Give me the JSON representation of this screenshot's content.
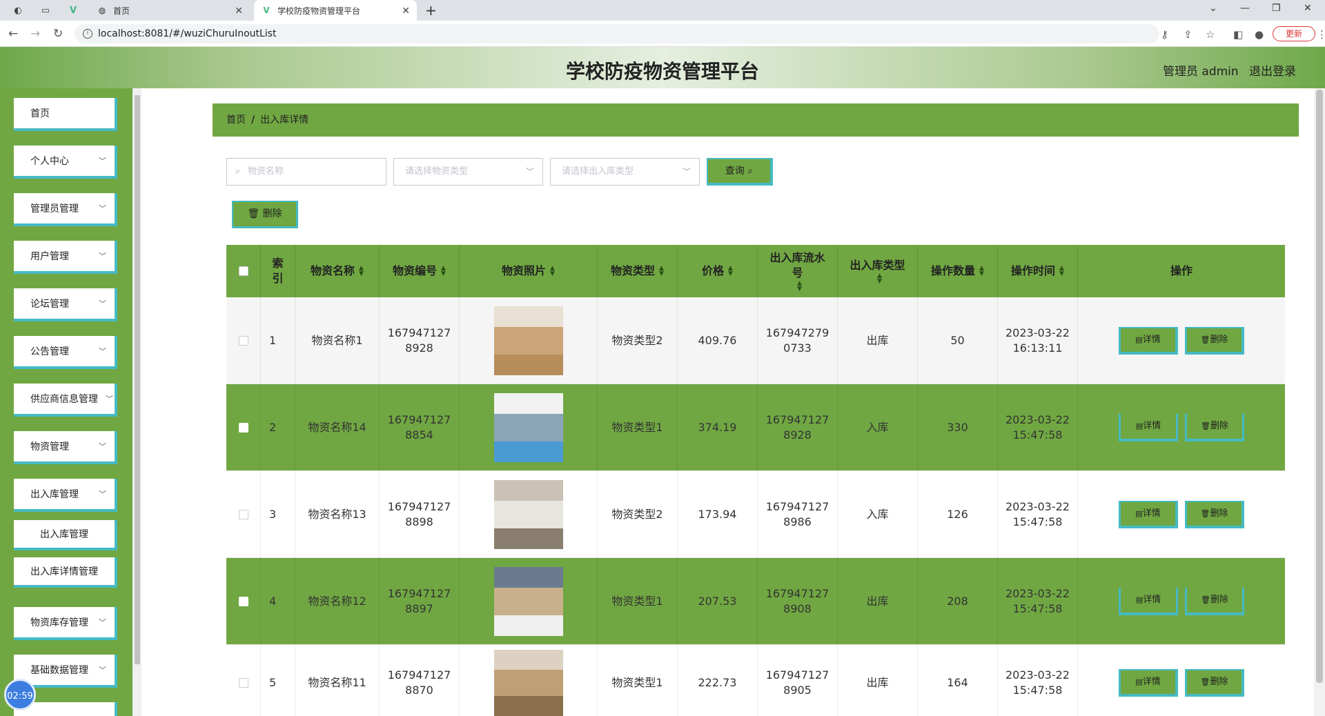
{
  "browser": {
    "tabs": [
      {
        "title": "首页"
      },
      {
        "title": "学校防疫物资管理平台"
      }
    ],
    "url": "localhost:8081/#/wuziChuruInoutList",
    "update_label": "更新"
  },
  "header": {
    "title": "学校防疫物资管理平台",
    "admin_label": "管理员 admin",
    "logout_label": "退出登录"
  },
  "sidebar": {
    "items": [
      {
        "label": "首页",
        "has_arrow": false
      },
      {
        "label": "个人中心",
        "has_arrow": true
      },
      {
        "label": "管理员管理",
        "has_arrow": true
      },
      {
        "label": "用户管理",
        "has_arrow": true
      },
      {
        "label": "论坛管理",
        "has_arrow": true
      },
      {
        "label": "公告管理",
        "has_arrow": true
      },
      {
        "label": "供应商信息管理",
        "has_arrow": true
      },
      {
        "label": "物资管理",
        "has_arrow": true
      },
      {
        "label": "出入库管理",
        "has_arrow": true
      }
    ],
    "subitems": [
      {
        "label": "出入库管理"
      },
      {
        "label": "出入库详情管理"
      }
    ],
    "items_after": [
      {
        "label": "物资库存管理"
      },
      {
        "label": "基础数据管理"
      }
    ],
    "clock": "02:59"
  },
  "breadcrumb": {
    "home": "首页",
    "current": "出入库详情"
  },
  "filters": {
    "name_placeholder": "物资名称",
    "type_placeholder": "请选择物资类型",
    "inout_placeholder": "请选择出入库类型",
    "query_label": "查询",
    "delete_label": "删除"
  },
  "table": {
    "headers": {
      "index": "索引",
      "name": "物资名称",
      "code": "物资编号",
      "photo": "物资照片",
      "type": "物资类型",
      "price": "价格",
      "serial": "出入库流水号",
      "inout_type": "出入库类型",
      "qty": "操作数量",
      "time": "操作时间",
      "ops": "操作"
    },
    "detail_label": "详情",
    "delete_label": "删除",
    "rows": [
      {
        "index": "1",
        "name": "物资名称1",
        "code": "1679471278928",
        "type": "物资类型2",
        "price": "409.76",
        "serial": "1679472790733",
        "inout": "出库",
        "qty": "50",
        "date": "2023-03-22",
        "time": "16:13:11"
      },
      {
        "index": "2",
        "name": "物资名称14",
        "code": "1679471278854",
        "type": "物资类型1",
        "price": "374.19",
        "serial": "1679471278928",
        "inout": "入库",
        "qty": "330",
        "date": "2023-03-22",
        "time": "15:47:58"
      },
      {
        "index": "3",
        "name": "物资名称13",
        "code": "1679471278898",
        "type": "物资类型2",
        "price": "173.94",
        "serial": "1679471278986",
        "inout": "入库",
        "qty": "126",
        "date": "2023-03-22",
        "time": "15:47:58"
      },
      {
        "index": "4",
        "name": "物资名称12",
        "code": "1679471278897",
        "type": "物资类型1",
        "price": "207.53",
        "serial": "1679471278908",
        "inout": "出库",
        "qty": "208",
        "date": "2023-03-22",
        "time": "15:47:58"
      },
      {
        "index": "5",
        "name": "物资名称11",
        "code": "1679471278870",
        "type": "物资类型1",
        "price": "222.73",
        "serial": "1679471278905",
        "inout": "出库",
        "qty": "164",
        "date": "2023-03-22",
        "time": "15:47:58"
      }
    ]
  },
  "colors": {
    "accent_green": "#70a742",
    "border_teal": "#45bac4"
  }
}
